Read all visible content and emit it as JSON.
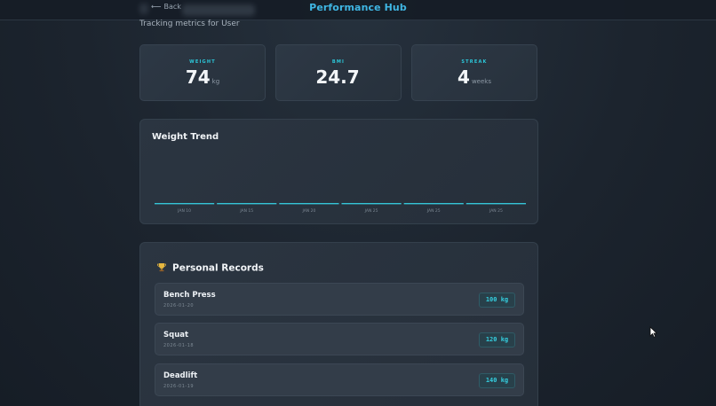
{
  "header": {
    "back_label": "Back",
    "back_arrow": "⟵",
    "brand": "Performance Hub"
  },
  "subtitle": "Tracking metrics for User",
  "stats": [
    {
      "label": "WEIGHT",
      "value": "74",
      "unit": "kg"
    },
    {
      "label": "BMI",
      "value": "24.7",
      "unit": ""
    },
    {
      "label": "STREAK",
      "value": "4",
      "unit": "weeks"
    }
  ],
  "weight_trend": {
    "title": "Weight Trend",
    "line_color": "#35c4d6",
    "points": [
      {
        "label": "JAN 10"
      },
      {
        "label": "JAN 15"
      },
      {
        "label": "JAN 20"
      },
      {
        "label": "JAN 25"
      },
      {
        "label": "JAN 25"
      },
      {
        "label": "JAN 25"
      }
    ]
  },
  "records": {
    "icon": "trophy-icon",
    "title": "Personal Records",
    "items": [
      {
        "name": "Bench Press",
        "date": "2026-01-20",
        "value": "100 kg"
      },
      {
        "name": "Squat",
        "date": "2026-01-18",
        "value": "120 kg"
      },
      {
        "name": "Deadlift",
        "date": "2026-01-19",
        "value": "140 kg"
      }
    ]
  },
  "colors": {
    "accent": "#3fb6e3",
    "teal": "#2cc7d9",
    "background": "#1c242e"
  }
}
